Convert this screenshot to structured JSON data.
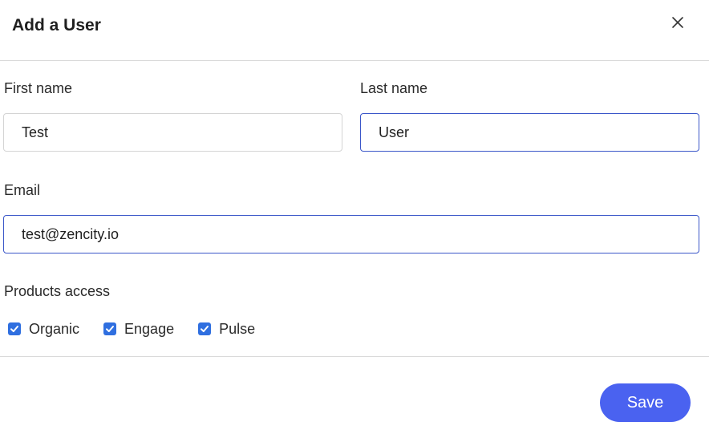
{
  "dialog": {
    "title": "Add a User"
  },
  "form": {
    "first_name": {
      "label": "First name",
      "value": "Test"
    },
    "last_name": {
      "label": "Last name",
      "value": "User"
    },
    "email": {
      "label": "Email",
      "value": "test@zencity.io"
    },
    "products": {
      "label": "Products access",
      "options": [
        {
          "label": "Organic",
          "checked": true
        },
        {
          "label": "Engage",
          "checked": true
        },
        {
          "label": "Pulse",
          "checked": true
        }
      ]
    }
  },
  "actions": {
    "save_label": "Save"
  },
  "colors": {
    "accent": "#4a62f0",
    "checkbox": "#2f6fe0",
    "focus_border": "#3b57c9"
  },
  "icons": {
    "close": "close-icon",
    "check": "checkmark-icon"
  }
}
